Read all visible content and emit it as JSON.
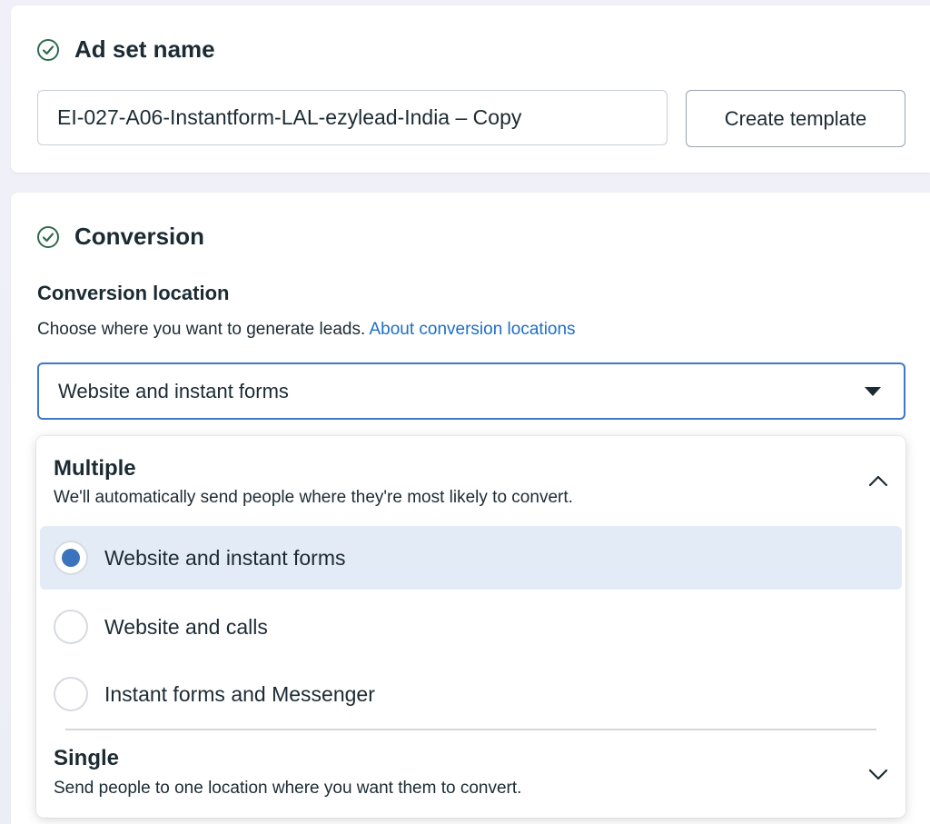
{
  "adset": {
    "title": "Ad set name",
    "name_value": "EI-027-A06-Instantform-LAL-ezylead-India – Copy",
    "template_button": "Create template"
  },
  "conversion": {
    "title": "Conversion",
    "location_label": "Conversion location",
    "help_text": "Choose where you want to generate leads.",
    "help_link": "About conversion locations",
    "selected_value": "Website and instant forms"
  },
  "dropdown": {
    "multiple": {
      "title": "Multiple",
      "description": "We'll automatically send people where they're most likely to convert.",
      "expanded": true,
      "options": [
        {
          "label": "Website and instant forms",
          "selected": true
        },
        {
          "label": "Website and calls",
          "selected": false
        },
        {
          "label": "Instant forms and Messenger",
          "selected": false
        }
      ]
    },
    "single": {
      "title": "Single",
      "description": "Send people to one location where you want them to convert.",
      "expanded": false
    }
  },
  "icons": {
    "section_check": "check-circle-icon",
    "select_caret": "caret-down-icon",
    "collapse": "chevron-up-icon",
    "expand": "chevron-down-icon"
  },
  "colors": {
    "accent": "#3b73bd",
    "link": "#1d6ec5",
    "check_green": "#2f6b4f",
    "selected_row": "#e3ebf6"
  }
}
